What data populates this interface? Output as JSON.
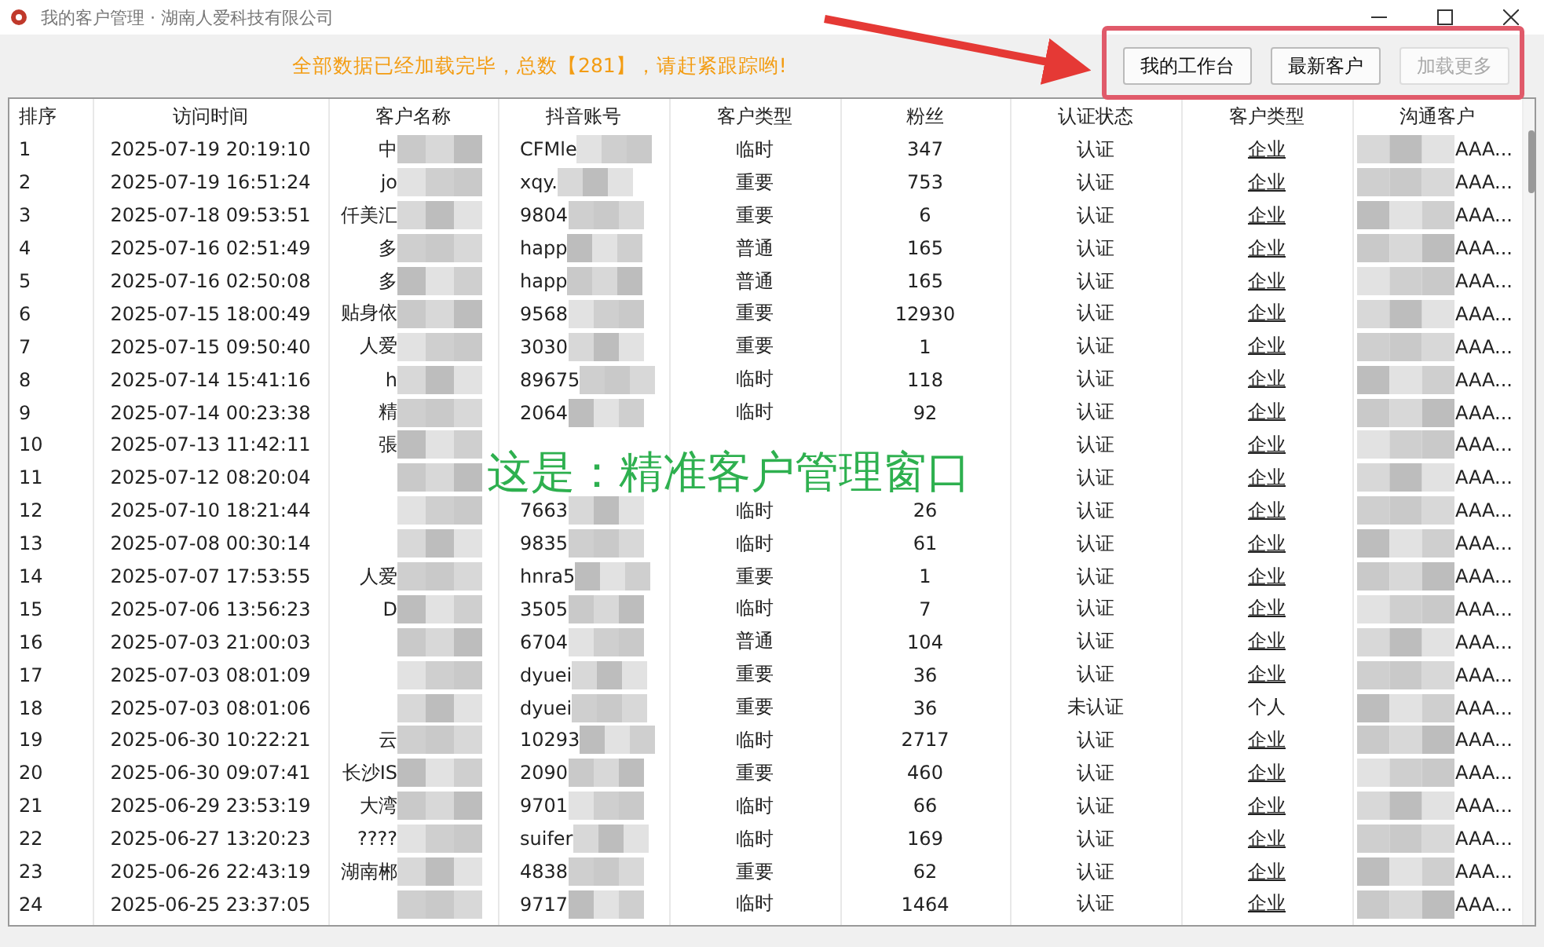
{
  "window": {
    "title": "我的客户管理 · 湖南人爱科技有限公司"
  },
  "toolbar": {
    "message": "全部数据已经加载完毕，总数【281】，请赶紧跟踪哟!",
    "buttons": [
      {
        "label": "我的工作台",
        "disabled": false
      },
      {
        "label": "最新客户",
        "disabled": false
      },
      {
        "label": "加载更多",
        "disabled": true
      }
    ]
  },
  "table": {
    "columns": [
      "排序",
      "访问时间",
      "客户名称",
      "抖音账号",
      "客户类型",
      "粉丝",
      "认证状态",
      "客户类型",
      "沟通客户"
    ],
    "rows": [
      {
        "index": "1",
        "time": "2025-07-19 20:19:10",
        "name": "中",
        "account": "CFMle",
        "type": "临时",
        "fans": "347",
        "verified": "认证",
        "category": "企业",
        "linked": true,
        "contact": "AAA..."
      },
      {
        "index": "2",
        "time": "2025-07-19 16:51:24",
        "name": "jo",
        "account": "xqy.",
        "type": "重要",
        "fans": "753",
        "verified": "认证",
        "category": "企业",
        "linked": true,
        "contact": "AAA..."
      },
      {
        "index": "3",
        "time": "2025-07-18 09:53:51",
        "name": "仟美汇",
        "account": "9804",
        "type": "重要",
        "fans": "6",
        "verified": "认证",
        "category": "企业",
        "linked": true,
        "contact": "AAA..."
      },
      {
        "index": "4",
        "time": "2025-07-16 02:51:49",
        "name": "多",
        "account": "happ",
        "type": "普通",
        "fans": "165",
        "verified": "认证",
        "category": "企业",
        "linked": true,
        "contact": "AAA..."
      },
      {
        "index": "5",
        "time": "2025-07-16 02:50:08",
        "name": "多",
        "account": "happ",
        "type": "普通",
        "fans": "165",
        "verified": "认证",
        "category": "企业",
        "linked": true,
        "contact": "AAA..."
      },
      {
        "index": "6",
        "time": "2025-07-15 18:00:49",
        "name": "贴身依",
        "account": "9568",
        "type": "重要",
        "fans": "12930",
        "verified": "认证",
        "category": "企业",
        "linked": true,
        "contact": "AAA..."
      },
      {
        "index": "7",
        "time": "2025-07-15 09:50:40",
        "name": "人爱",
        "account": "3030",
        "type": "重要",
        "fans": "1",
        "verified": "认证",
        "category": "企业",
        "linked": true,
        "contact": "AAA..."
      },
      {
        "index": "8",
        "time": "2025-07-14 15:41:16",
        "name": "h",
        "account": "89675",
        "type": "临时",
        "fans": "118",
        "verified": "认证",
        "category": "企业",
        "linked": true,
        "contact": "AAA..."
      },
      {
        "index": "9",
        "time": "2025-07-14 00:23:38",
        "name": "精",
        "account": "2064",
        "type": "临时",
        "fans": "92",
        "verified": "认证",
        "category": "企业",
        "linked": true,
        "contact": "AAA..."
      },
      {
        "index": "10",
        "time": "2025-07-13 11:42:11",
        "name": "張",
        "verified": "认证",
        "category": "企业",
        "linked": true,
        "contact": "AAA..."
      },
      {
        "index": "11",
        "time": "2025-07-12 08:20:04",
        "verified": "认证",
        "category": "企业",
        "linked": true,
        "contact": "AAA..."
      },
      {
        "index": "12",
        "time": "2025-07-10 18:21:44",
        "account": "7663",
        "type": "临时",
        "fans": "26",
        "verified": "认证",
        "category": "企业",
        "linked": true,
        "contact": "AAA..."
      },
      {
        "index": "13",
        "time": "2025-07-08 00:30:14",
        "account": "9835",
        "type": "临时",
        "fans": "61",
        "verified": "认证",
        "category": "企业",
        "linked": true,
        "contact": "AAA..."
      },
      {
        "index": "14",
        "time": "2025-07-07 17:53:55",
        "name": "人爱",
        "account": "hnra5",
        "type": "重要",
        "fans": "1",
        "verified": "认证",
        "category": "企业",
        "linked": true,
        "contact": "AAA..."
      },
      {
        "index": "15",
        "time": "2025-07-06 13:56:23",
        "name": "D",
        "account": "3505",
        "type": "临时",
        "fans": "7",
        "verified": "认证",
        "category": "企业",
        "linked": true,
        "contact": "AAA..."
      },
      {
        "index": "16",
        "time": "2025-07-03 21:00:03",
        "account": "6704",
        "type": "普通",
        "fans": "104",
        "verified": "认证",
        "category": "企业",
        "linked": true,
        "contact": "AAA..."
      },
      {
        "index": "17",
        "time": "2025-07-03 08:01:09",
        "account": "dyuei",
        "type": "重要",
        "fans": "36",
        "verified": "认证",
        "category": "企业",
        "linked": true,
        "contact": "AAA..."
      },
      {
        "index": "18",
        "time": "2025-07-03 08:01:06",
        "account": "dyuei",
        "type": "重要",
        "fans": "36",
        "verified": "未认证",
        "category": "个人",
        "linked": false,
        "contact": "AAA..."
      },
      {
        "index": "19",
        "time": "2025-06-30 10:22:21",
        "name": "云",
        "account": "10293",
        "type": "临时",
        "fans": "2717",
        "verified": "认证",
        "category": "企业",
        "linked": true,
        "contact": "AAA..."
      },
      {
        "index": "20",
        "time": "2025-06-30 09:07:41",
        "name": "长沙IS",
        "account": "2090",
        "type": "重要",
        "fans": "460",
        "verified": "认证",
        "category": "企业",
        "linked": true,
        "contact": "AAA..."
      },
      {
        "index": "21",
        "time": "2025-06-29 23:53:19",
        "name": "大湾",
        "account": "9701",
        "type": "临时",
        "fans": "66",
        "verified": "认证",
        "category": "企业",
        "linked": true,
        "contact": "AAA..."
      },
      {
        "index": "22",
        "time": "2025-06-27 13:20:23",
        "name": "????",
        "account": "suifer",
        "type": "临时",
        "fans": "169",
        "verified": "认证",
        "category": "企业",
        "linked": true,
        "contact": "AAA..."
      },
      {
        "index": "23",
        "time": "2025-06-26 22:43:19",
        "name": "湖南郴",
        "account": "4838",
        "type": "重要",
        "fans": "62",
        "verified": "认证",
        "category": "企业",
        "linked": true,
        "contact": "AAA..."
      },
      {
        "index": "24",
        "time": "2025-06-25 23:37:05",
        "account": "9717",
        "type": "临时",
        "fans": "1464",
        "verified": "认证",
        "category": "企业",
        "linked": true,
        "contact": "AAA..."
      }
    ]
  },
  "annotation": {
    "text": "这是：精准客户管理窗口"
  }
}
